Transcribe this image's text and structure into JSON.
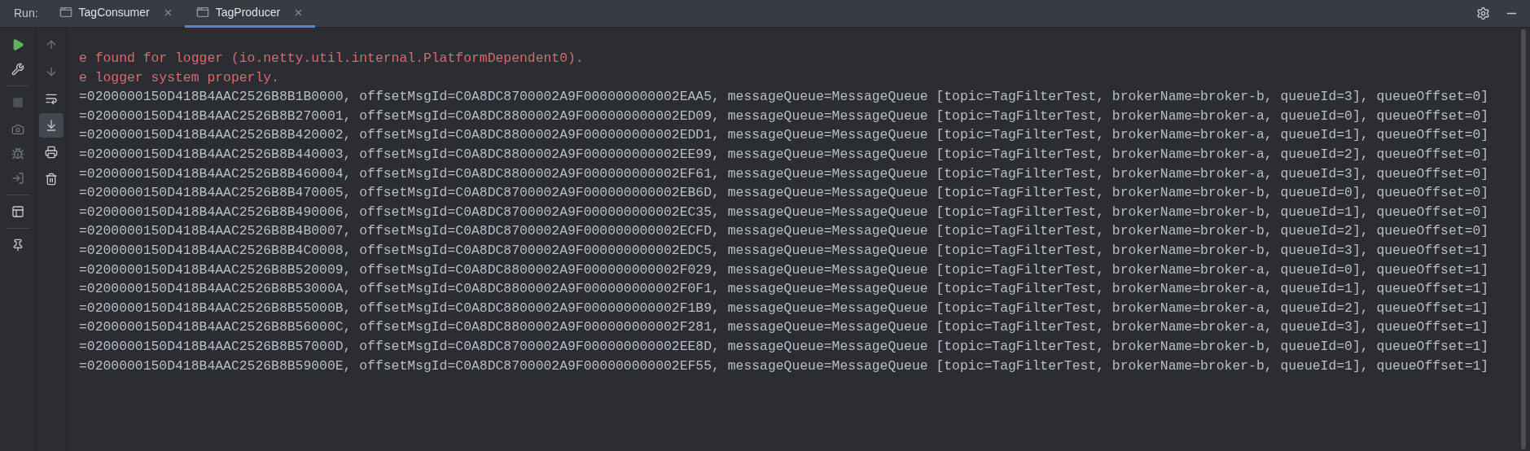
{
  "run_label": "Run:",
  "tabs": [
    {
      "label": "TagConsumer",
      "selected": false
    },
    {
      "label": "TagProducer",
      "selected": true
    }
  ],
  "run_toolbar": {
    "stop_disabled": true
  },
  "console_toolbar": {
    "soft_wrap_on": false,
    "scroll_to_end_on": true
  },
  "log_lines": [
    {
      "kind": "error",
      "text": "e found for logger (io.netty.util.internal.PlatformDependent0)."
    },
    {
      "kind": "error",
      "text": "e logger system properly."
    },
    {
      "kind": "output",
      "text": "=0200000150D418B4AAC2526B8B1B0000, offsetMsgId=C0A8DC8700002A9F000000000002EAA5, messageQueue=MessageQueue [topic=TagFilterTest, brokerName=broker-b, queueId=3], queueOffset=0]"
    },
    {
      "kind": "output",
      "text": "=0200000150D418B4AAC2526B8B270001, offsetMsgId=C0A8DC8800002A9F000000000002ED09, messageQueue=MessageQueue [topic=TagFilterTest, brokerName=broker-a, queueId=0], queueOffset=0]"
    },
    {
      "kind": "output",
      "text": "=0200000150D418B4AAC2526B8B420002, offsetMsgId=C0A8DC8800002A9F000000000002EDD1, messageQueue=MessageQueue [topic=TagFilterTest, brokerName=broker-a, queueId=1], queueOffset=0]"
    },
    {
      "kind": "output",
      "text": "=0200000150D418B4AAC2526B8B440003, offsetMsgId=C0A8DC8800002A9F000000000002EE99, messageQueue=MessageQueue [topic=TagFilterTest, brokerName=broker-a, queueId=2], queueOffset=0]"
    },
    {
      "kind": "output",
      "text": "=0200000150D418B4AAC2526B8B460004, offsetMsgId=C0A8DC8800002A9F000000000002EF61, messageQueue=MessageQueue [topic=TagFilterTest, brokerName=broker-a, queueId=3], queueOffset=0]"
    },
    {
      "kind": "output",
      "text": "=0200000150D418B4AAC2526B8B470005, offsetMsgId=C0A8DC8700002A9F000000000002EB6D, messageQueue=MessageQueue [topic=TagFilterTest, brokerName=broker-b, queueId=0], queueOffset=0]"
    },
    {
      "kind": "output",
      "text": "=0200000150D418B4AAC2526B8B490006, offsetMsgId=C0A8DC8700002A9F000000000002EC35, messageQueue=MessageQueue [topic=TagFilterTest, brokerName=broker-b, queueId=1], queueOffset=0]"
    },
    {
      "kind": "output",
      "text": "=0200000150D418B4AAC2526B8B4B0007, offsetMsgId=C0A8DC8700002A9F000000000002ECFD, messageQueue=MessageQueue [topic=TagFilterTest, brokerName=broker-b, queueId=2], queueOffset=0]"
    },
    {
      "kind": "output",
      "text": "=0200000150D418B4AAC2526B8B4C0008, offsetMsgId=C0A8DC8700002A9F000000000002EDC5, messageQueue=MessageQueue [topic=TagFilterTest, brokerName=broker-b, queueId=3], queueOffset=1]"
    },
    {
      "kind": "output",
      "text": "=0200000150D418B4AAC2526B8B520009, offsetMsgId=C0A8DC8800002A9F000000000002F029, messageQueue=MessageQueue [topic=TagFilterTest, brokerName=broker-a, queueId=0], queueOffset=1]"
    },
    {
      "kind": "output",
      "text": "=0200000150D418B4AAC2526B8B53000A, offsetMsgId=C0A8DC8800002A9F000000000002F0F1, messageQueue=MessageQueue [topic=TagFilterTest, brokerName=broker-a, queueId=1], queueOffset=1]"
    },
    {
      "kind": "output",
      "text": "=0200000150D418B4AAC2526B8B55000B, offsetMsgId=C0A8DC8800002A9F000000000002F1B9, messageQueue=MessageQueue [topic=TagFilterTest, brokerName=broker-a, queueId=2], queueOffset=1]"
    },
    {
      "kind": "output",
      "text": "=0200000150D418B4AAC2526B8B56000C, offsetMsgId=C0A8DC8800002A9F000000000002F281, messageQueue=MessageQueue [topic=TagFilterTest, brokerName=broker-a, queueId=3], queueOffset=1]"
    },
    {
      "kind": "output",
      "text": "=0200000150D418B4AAC2526B8B57000D, offsetMsgId=C0A8DC8700002A9F000000000002EE8D, messageQueue=MessageQueue [topic=TagFilterTest, brokerName=broker-b, queueId=0], queueOffset=1]"
    },
    {
      "kind": "output",
      "text": "=0200000150D418B4AAC2526B8B59000E, offsetMsgId=C0A8DC8700002A9F000000000002EF55, messageQueue=MessageQueue [topic=TagFilterTest, brokerName=broker-b, queueId=1], queueOffset=1]"
    }
  ]
}
